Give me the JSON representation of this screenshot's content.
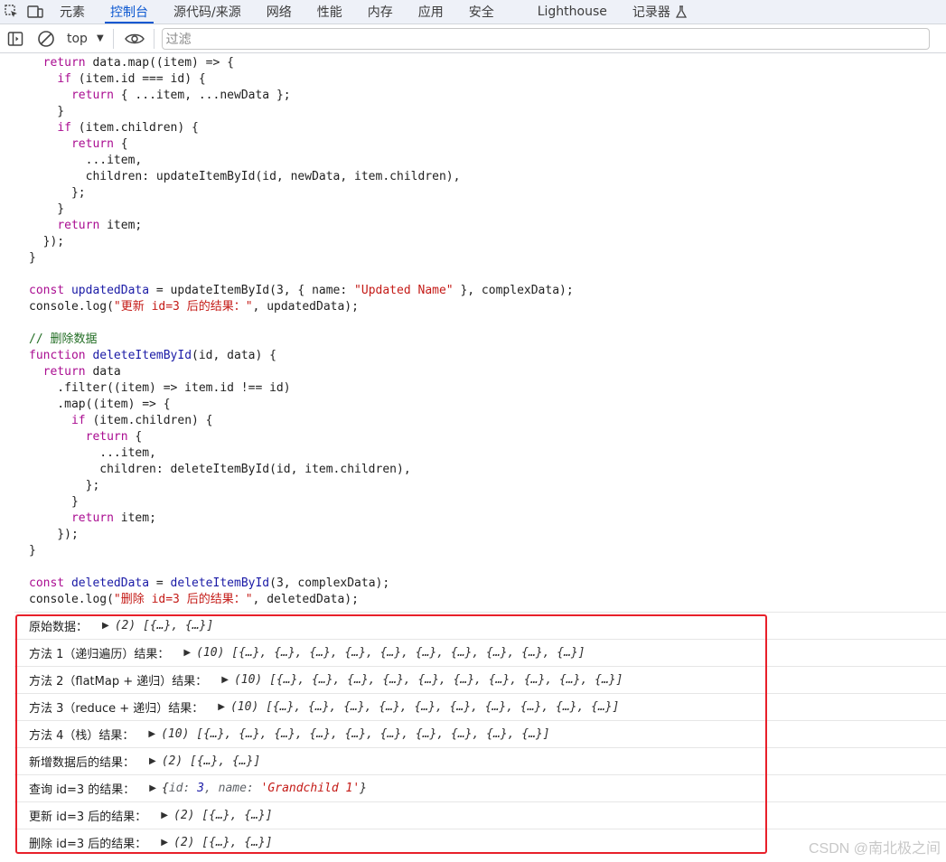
{
  "tabs": [
    {
      "label": "元素"
    },
    {
      "label": "控制台"
    },
    {
      "label": "源代码/来源"
    },
    {
      "label": "网络"
    },
    {
      "label": "性能"
    },
    {
      "label": "内存"
    },
    {
      "label": "应用"
    },
    {
      "label": "安全"
    },
    {
      "label": "Lighthouse"
    },
    {
      "label": "记录器"
    }
  ],
  "active_tab": "控制台",
  "toolbar": {
    "context": "top",
    "filter_placeholder": "过滤"
  },
  "code_lines": [
    "  return data.map((item) => {",
    "    if (item.id === id) {",
    "      return { ...item, ...newData };",
    "    }",
    "    if (item.children) {",
    "      return {",
    "        ...item,",
    "        children: updateItemById(id, newData, item.children),",
    "      };",
    "    }",
    "    return item;",
    "  });",
    "}",
    "",
    "const updatedData = updateItemById(3, { name: \"Updated Name\" }, complexData);",
    "console.log(\"更新 id=3 后的结果：\", updatedData);",
    "",
    "// 删除数据",
    "function deleteItemById(id, data) {",
    "  return data",
    "    .filter((item) => item.id !== id)",
    "    .map((item) => {",
    "      if (item.children) {",
    "        return {",
    "          ...item,",
    "          children: deleteItemById(id, item.children),",
    "        };",
    "      }",
    "      return item;",
    "    });",
    "}",
    "",
    "const deletedData = deleteItemById(3, complexData);",
    "console.log(\"删除 id=3 后的结果：\", deletedData);"
  ],
  "logs": [
    {
      "label": "原始数据：",
      "value": "(2) [{…}, {…}]"
    },
    {
      "label": "方法 1（递归遍历）结果：",
      "value": "(10) [{…}, {…}, {…}, {…}, {…}, {…}, {…}, {…}, {…}, {…}]"
    },
    {
      "label": "方法 2（flatMap + 递归）结果：",
      "value": "(10) [{…}, {…}, {…}, {…}, {…}, {…}, {…}, {…}, {…}, {…}]"
    },
    {
      "label": "方法 3（reduce + 递归）结果：",
      "value": "(10) [{…}, {…}, {…}, {…}, {…}, {…}, {…}, {…}, {…}, {…}]"
    },
    {
      "label": "方法 4（栈）结果：",
      "value": "(10) [{…}, {…}, {…}, {…}, {…}, {…}, {…}, {…}, {…}, {…}]"
    },
    {
      "label": "新增数据后的结果：",
      "value": "(2) [{…}, {…}]"
    },
    {
      "label": "查询 id=3 的结果：",
      "object": {
        "open": "{",
        "k1": "id",
        "v1": "3",
        "k2": "name",
        "v2": "'Grandchild 1'",
        "close": "}"
      }
    },
    {
      "label": "更新 id=3 后的结果：",
      "value": "(2) [{…}, {…}]"
    },
    {
      "label": "删除 id=3 后的结果：",
      "value": "(2) [{…}, {…}]"
    }
  ],
  "watermark": "CSDN @南北极之间",
  "colors": {
    "accent": "#0b57d0",
    "highlight_border": "#e8202a",
    "keyword": "#aa0d91",
    "string": "#c41a16",
    "comment": "#236e25",
    "variable": "#1a1aa6"
  }
}
